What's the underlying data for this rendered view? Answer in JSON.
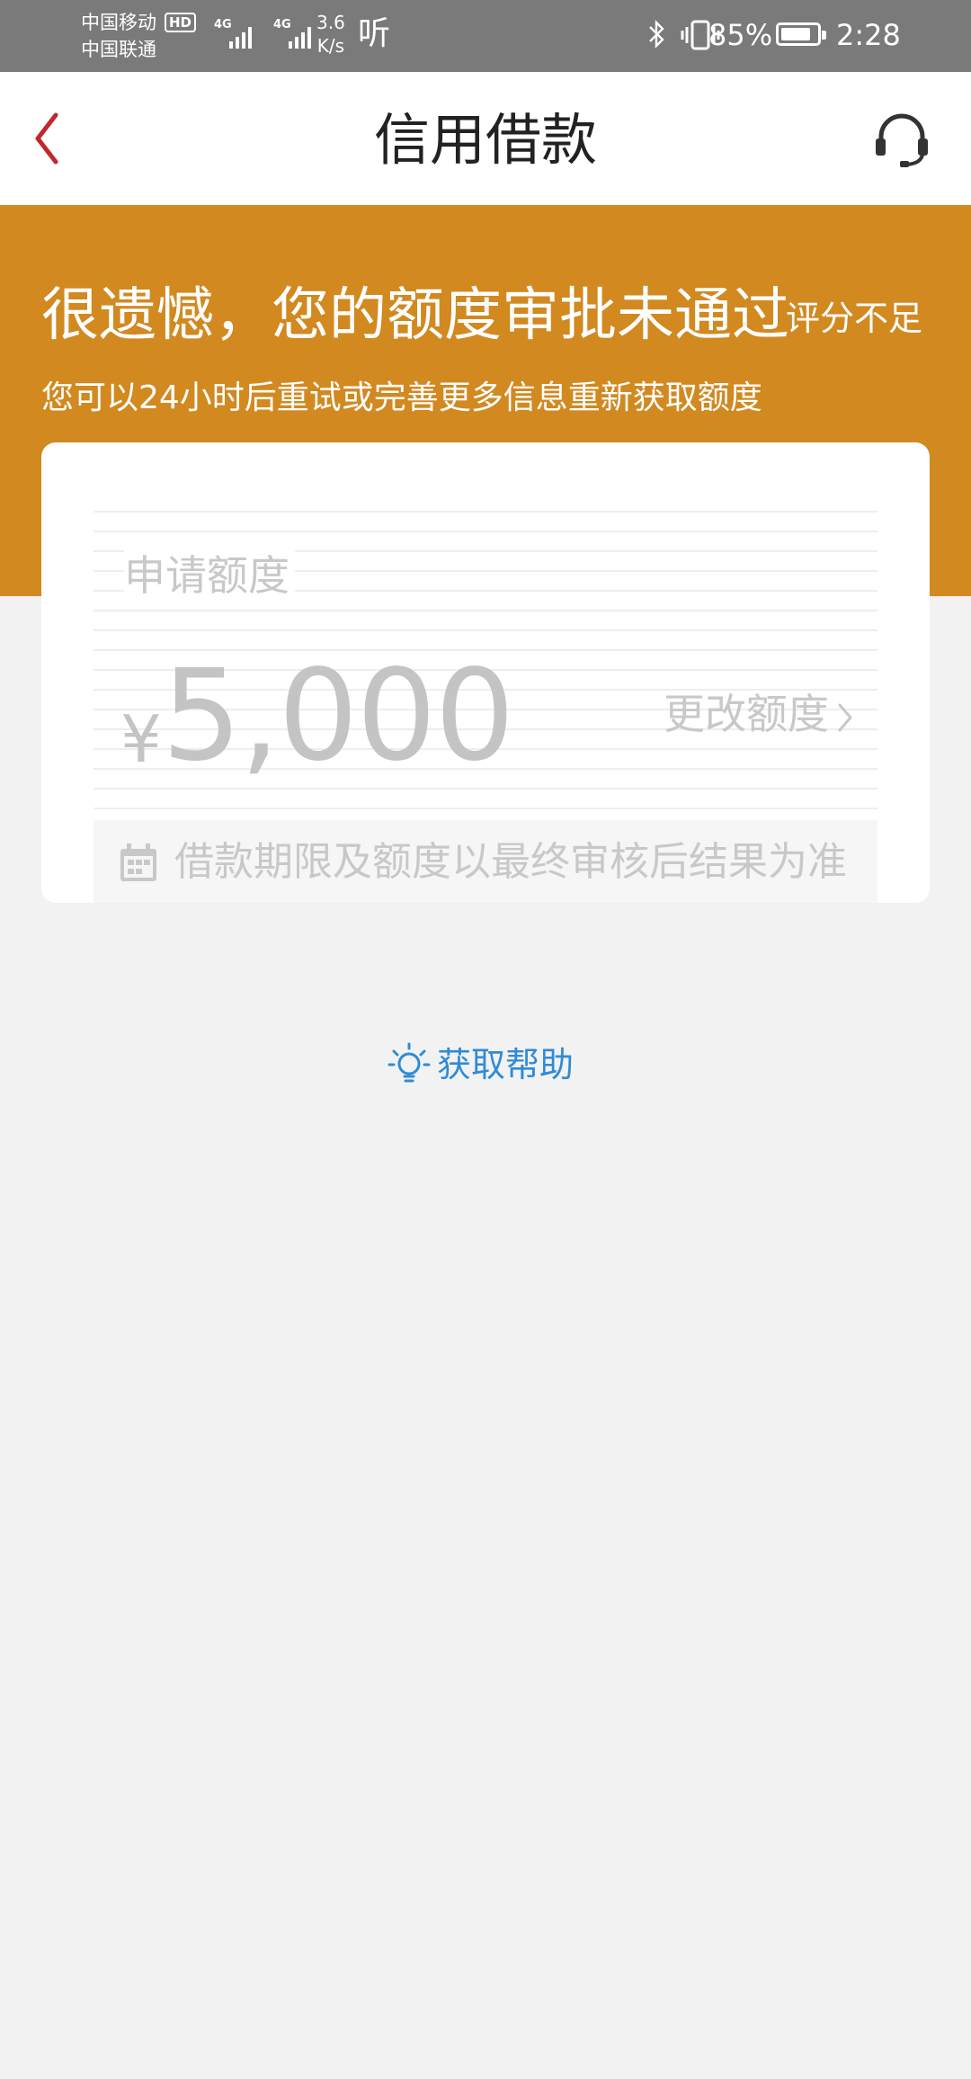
{
  "status_bar": {
    "carrier_1": "中国移动",
    "carrier_2": "中国联通",
    "hd_badge": "HD",
    "network_1": "4G",
    "network_2": "4G",
    "net_speed_value": "3.6",
    "net_speed_unit": "K/s",
    "listen_icon": "听",
    "bluetooth_icon": "bluetooth-icon",
    "vibrate_icon": "vibrate-icon",
    "battery_percent": "85%",
    "battery_level": 0.85,
    "time": "2:28"
  },
  "header": {
    "title": "信用借款",
    "back_icon": "chevron-left-icon",
    "support_icon": "headset-icon",
    "accent_color": "#c0282d"
  },
  "banner": {
    "title": "很遗憾，您的额度审批未通过",
    "reason_tag": "评分不足",
    "subtitle": "您可以24小时后重试或完善更多信息重新获取额度",
    "background_color": "#d18920"
  },
  "card": {
    "apply_label": "申请额度",
    "currency_symbol": "¥",
    "amount": "5,000",
    "change_amount_label": "更改额度",
    "note_icon": "calendar-icon",
    "note": "借款期限及额度以最终审核后结果为准"
  },
  "help": {
    "label": "获取帮助",
    "icon": "lightbulb-icon",
    "color": "#2f8bd6"
  }
}
